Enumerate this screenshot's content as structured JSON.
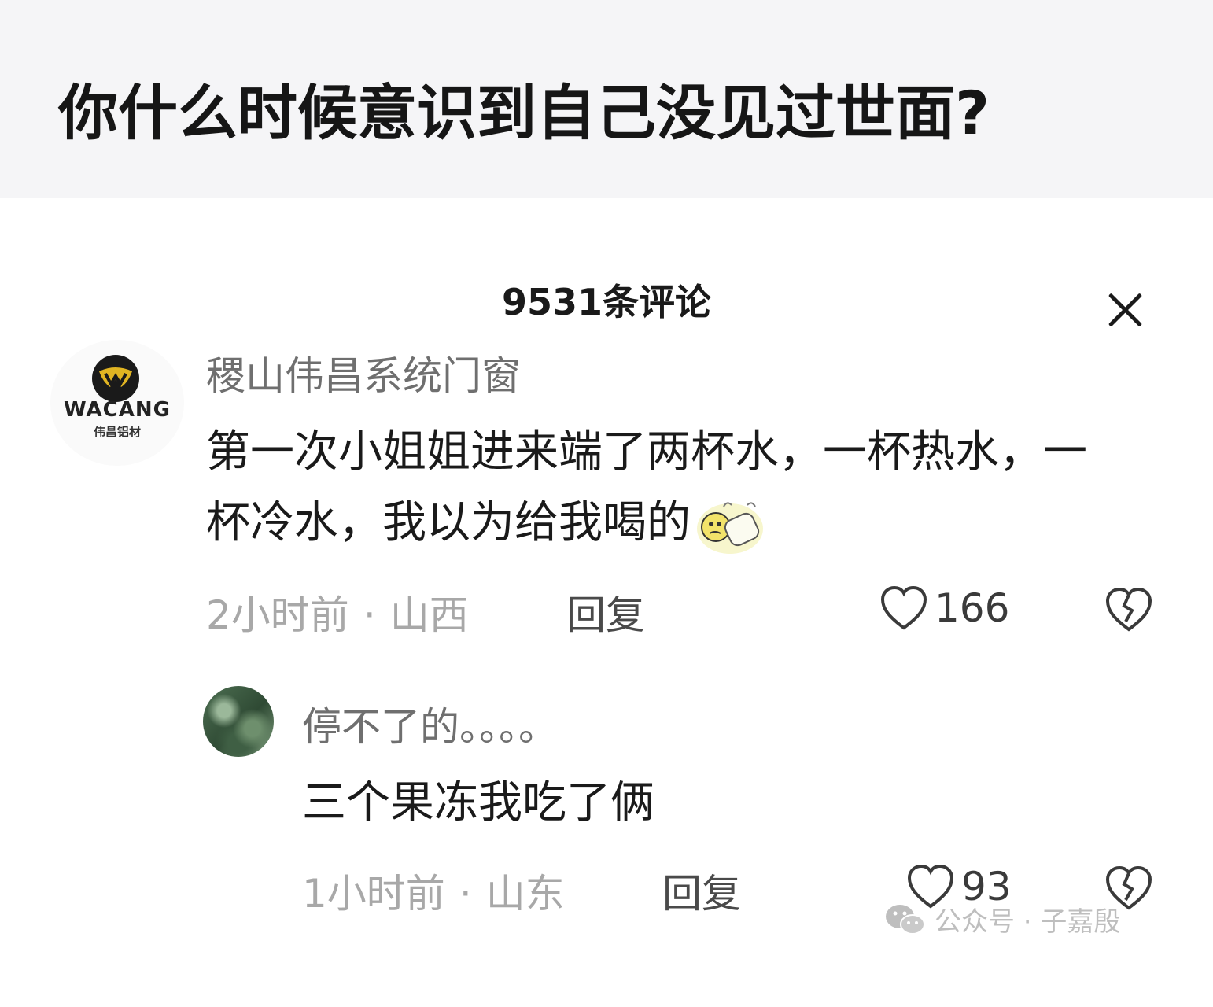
{
  "question": {
    "title": "你什么时候意识到自己没见过世面?"
  },
  "comments_panel": {
    "count_label": "9531条评论",
    "close_icon": "close-icon"
  },
  "comments": [
    {
      "avatar": {
        "brand_name": "WACANG",
        "brand_sub": "伟昌铝材"
      },
      "username": "稷山伟昌系统门窗",
      "text": "第一次小姐姐进来端了两杯水，一杯热水，一杯冷水，我以为给我喝的",
      "emoji": "embarrassed-cry-emoji",
      "time": "2小时前",
      "location": "山西",
      "reply_label": "回复",
      "likes": "166"
    },
    {
      "username": "停不了的。。。。",
      "text": "三个果冻我吃了俩",
      "time": "1小时前",
      "location": "山东",
      "reply_label": "回复",
      "likes": "93"
    }
  ],
  "separator": "·",
  "watermark": {
    "text": "公众号 · 子嘉殷",
    "icon": "wechat-icon"
  },
  "colors": {
    "header_bg": "#f5f5f7",
    "meta_gray": "#a8a8a8",
    "username_gray": "#6f6f6f"
  }
}
